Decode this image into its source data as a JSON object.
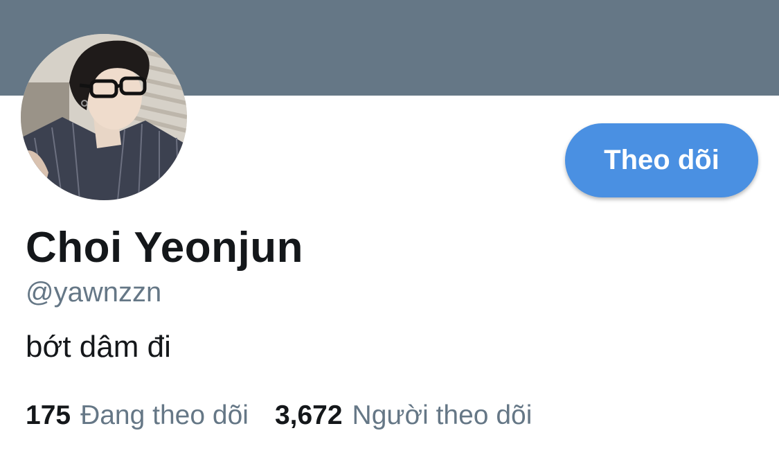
{
  "profile": {
    "banner_color": "#657786",
    "display_name": "Choi Yeonjun",
    "handle": "@yawnzzn",
    "bio": "bớt dâm đi",
    "follow_button_label": "Theo dõi",
    "follow_button_color": "#4a90e2",
    "stats": [
      {
        "count": "175",
        "label": "Đang theo dõi"
      },
      {
        "count": "3,672",
        "label": "Người theo dõi"
      }
    ],
    "avatar_icon": "profile-photo"
  }
}
